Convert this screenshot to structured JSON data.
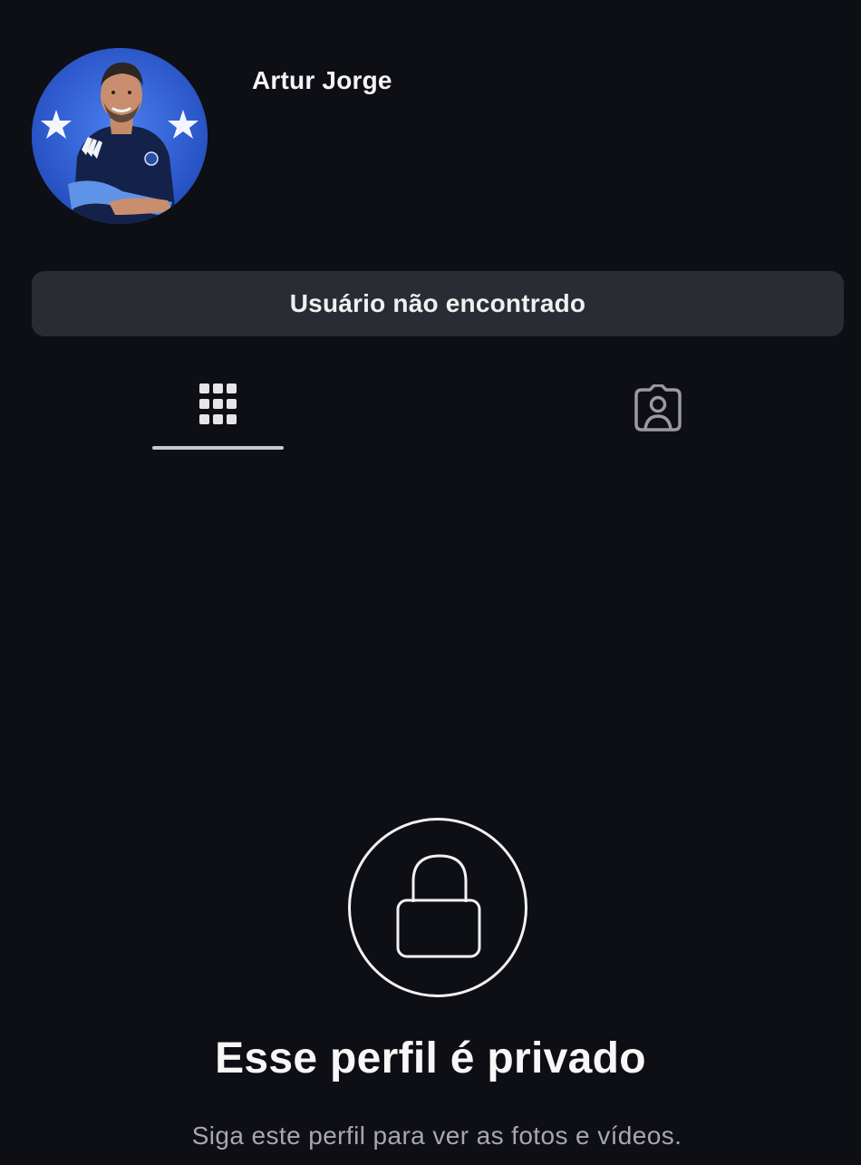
{
  "profile": {
    "name": "Artur Jorge",
    "avatar_icon": "profile-photo"
  },
  "status_button": {
    "label": "Usuário não encontrado"
  },
  "tabs": [
    {
      "icon": "grid-icon",
      "selected": true
    },
    {
      "icon": "tagged-person-icon",
      "selected": false
    }
  ],
  "private_notice": {
    "icon": "lock-icon",
    "title": "Esse perfil é privado",
    "subtitle": "Siga este perfil para ver as fotos e vídeos."
  },
  "colors": {
    "background": "#0e0f14",
    "button_background": "#2a2c33",
    "avatar_background": "#2f5cc9",
    "text_primary": "#f2f2f2",
    "text_secondary": "#a7a7ac"
  }
}
